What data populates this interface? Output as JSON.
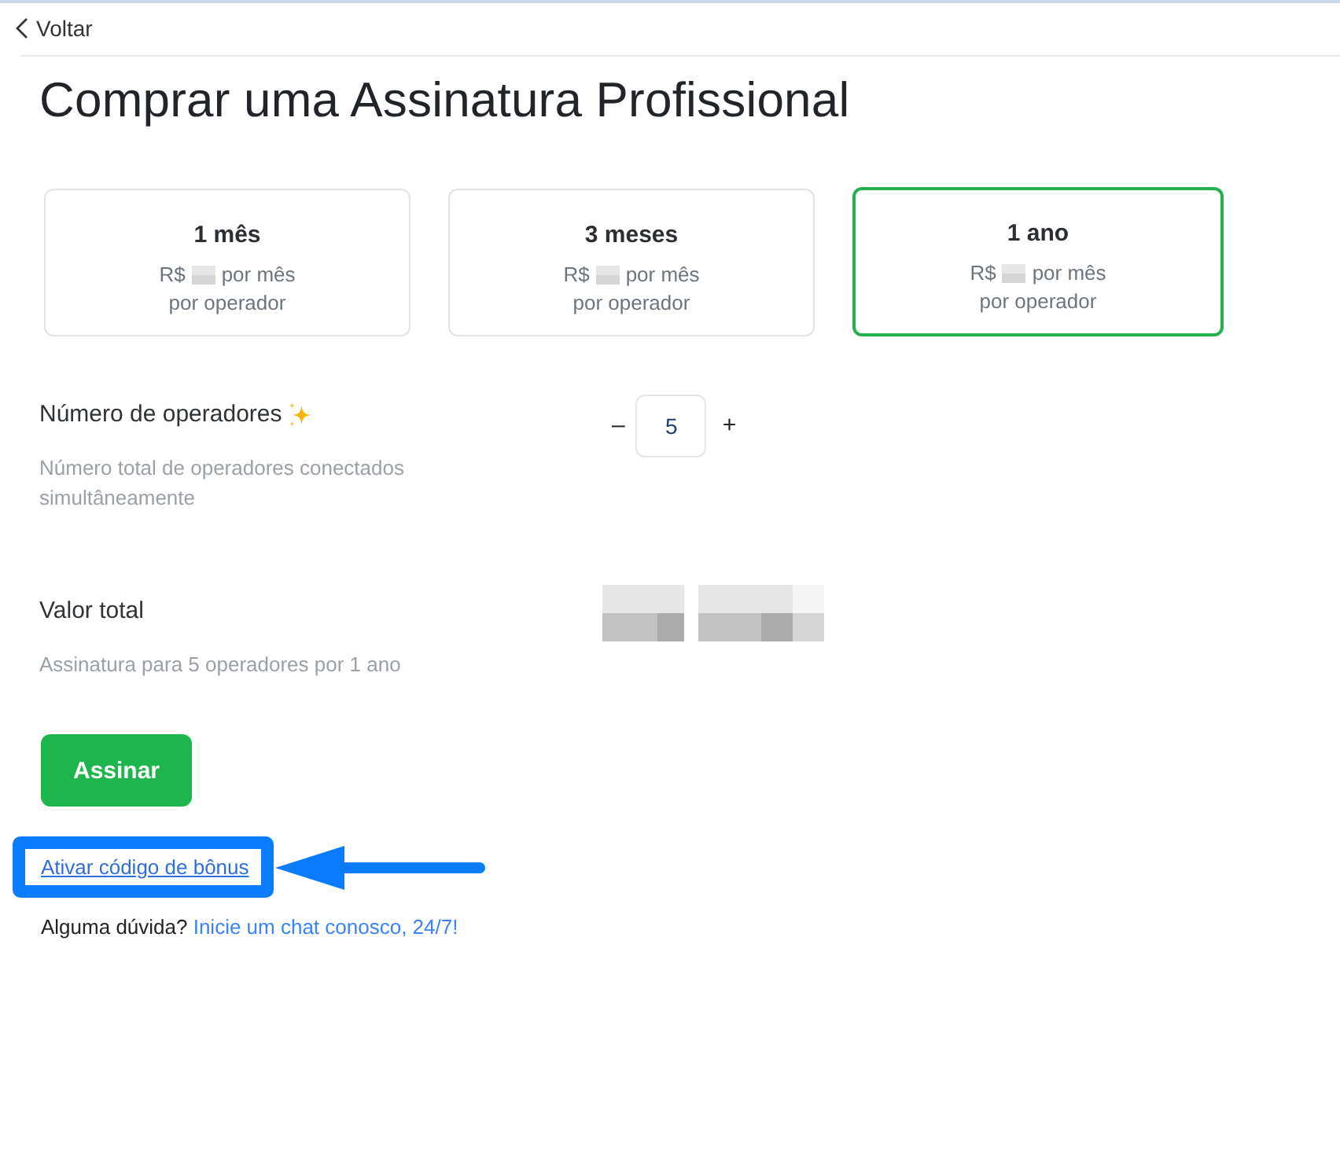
{
  "back_link": {
    "label": "Voltar"
  },
  "title": "Comprar uma Assinatura Profissional",
  "plans": [
    {
      "name": "1 mês",
      "price_prefix": "R$",
      "price_suffix": "por mês",
      "unit": "por operador",
      "selected": false
    },
    {
      "name": "3 meses",
      "price_prefix": "R$",
      "price_suffix": "por mês",
      "unit": "por operador",
      "selected": false
    },
    {
      "name": "1 ano",
      "price_prefix": "R$",
      "price_suffix": "por mês",
      "unit": "por operador",
      "selected": true
    }
  ],
  "operators": {
    "label": "Número de operadores",
    "hint": "Número total de operadores conectados simultâneamente",
    "decrement": "–",
    "value": "5",
    "increment": "+"
  },
  "total": {
    "label": "Valor total",
    "hint": "Assinatura para 5 operadores por 1 ano"
  },
  "subscribe_button": "Assinar",
  "bonus_link": {
    "label": "Ativar código de bônus",
    "highlighted": true
  },
  "help": {
    "text": "Alguma dúvida?",
    "link": "Inicie um chat conosco, 24/7!"
  }
}
